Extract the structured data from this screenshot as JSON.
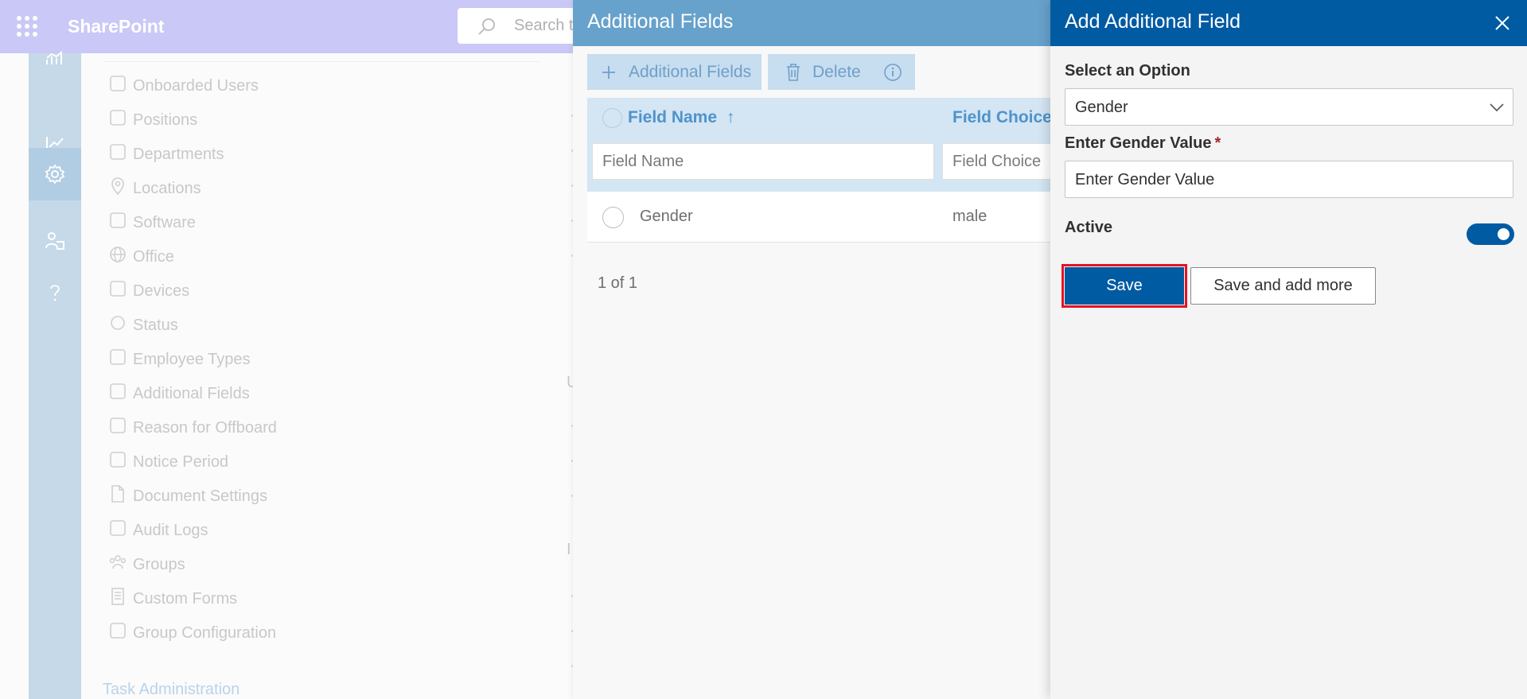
{
  "suite_bar": {
    "app_name": "SharePoint",
    "search_placeholder": "Search t"
  },
  "left_nav": {
    "items": [
      {
        "label": "Onboarded Users",
        "icon": "onboarded-users-icon"
      },
      {
        "label": "Positions",
        "icon": "positions-icon"
      },
      {
        "label": "Departments",
        "icon": "departments-icon"
      },
      {
        "label": "Locations",
        "icon": "location-pin-icon"
      },
      {
        "label": "Software",
        "icon": "software-icon"
      },
      {
        "label": "Office",
        "icon": "globe-icon"
      },
      {
        "label": "Devices",
        "icon": "devices-icon"
      },
      {
        "label": "Status",
        "icon": "status-circle-icon"
      },
      {
        "label": "Employee Types",
        "icon": "employee-types-icon"
      },
      {
        "label": "Additional Fields",
        "icon": "additional-fields-icon"
      },
      {
        "label": "Reason for Offboard",
        "icon": "offboard-icon"
      },
      {
        "label": "Notice Period",
        "icon": "calendar-clock-icon"
      },
      {
        "label": "Document Settings",
        "icon": "document-icon"
      },
      {
        "label": "Audit Logs",
        "icon": "audit-log-icon"
      },
      {
        "label": "Groups",
        "icon": "groups-icon"
      },
      {
        "label": "Custom Forms",
        "icon": "form-icon"
      },
      {
        "label": "Group Configuration",
        "icon": "group-config-icon"
      }
    ],
    "section_label": "Task Administration",
    "partial_letters": [
      "U",
      "I"
    ]
  },
  "additional_fields_panel": {
    "title": "Additional Fields",
    "add_button_label": "Additional Fields",
    "delete_button_label": "Delete",
    "columns": [
      "Field Name",
      "Field Choice"
    ],
    "sort_indicator": "↑",
    "filter_placeholders": [
      "Field Name",
      "Field Choice"
    ],
    "rows": [
      {
        "field_name": "Gender",
        "field_choice": "male"
      }
    ],
    "pager_text": "1 of 1"
  },
  "add_field_panel": {
    "title": "Add Additional Field",
    "select_label": "Select an Option",
    "select_value": "Gender",
    "value_label": "Enter Gender Value",
    "required_mark": "*",
    "value_placeholder": "Enter Gender Value",
    "active_label": "Active",
    "active_on": true,
    "save_label": "Save",
    "save_more_label": "Save and add more"
  },
  "colors": {
    "header_blue": "#005ba3",
    "highlight_red": "#e81123"
  }
}
